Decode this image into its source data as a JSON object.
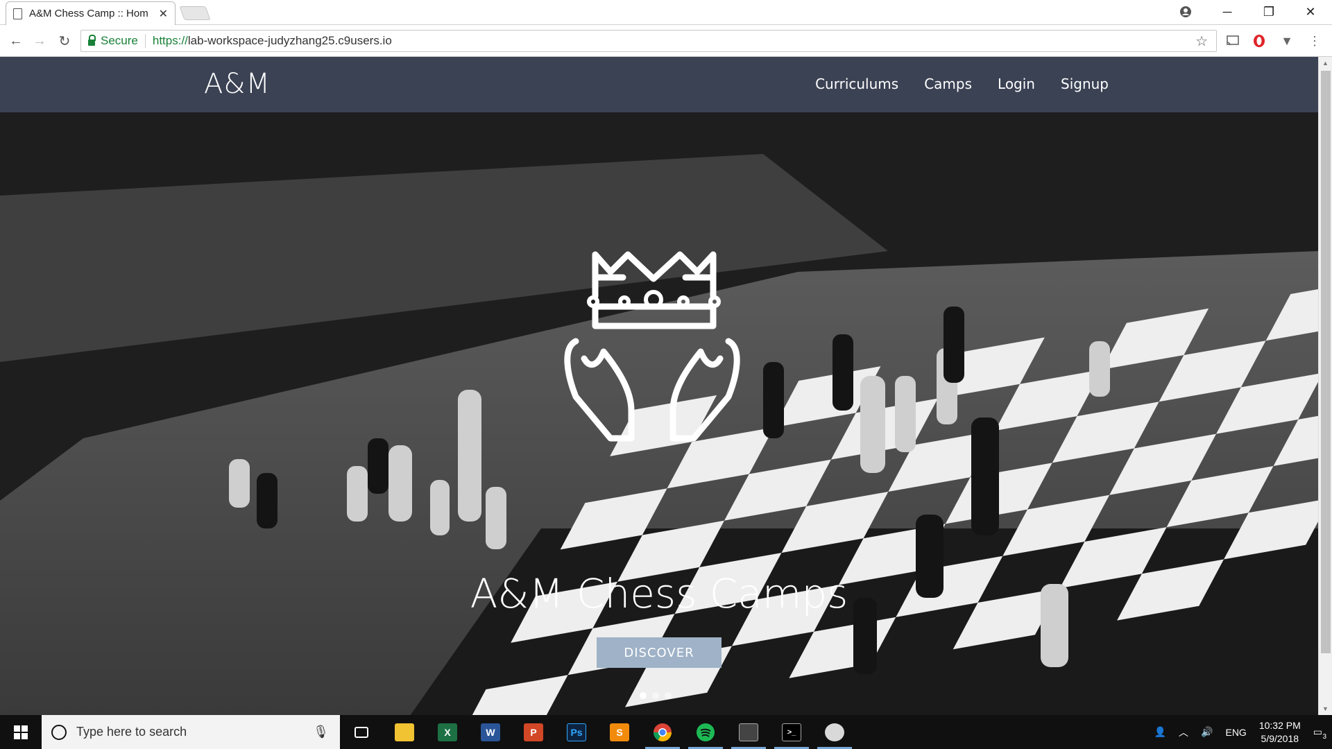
{
  "browser": {
    "tab_title": "A&M Chess Camp :: Hom",
    "secure_label": "Secure",
    "url_scheme": "https://",
    "url_rest": "lab-workspace-judyzhang25.c9users.io"
  },
  "site": {
    "brand": "A&M",
    "nav": [
      "Curriculums",
      "Camps",
      "Login",
      "Signup"
    ]
  },
  "hero": {
    "title": "A&M Chess Camps",
    "button": "DISCOVER",
    "slide_count": 3,
    "active_slide": 0
  },
  "taskbar": {
    "search_placeholder": "Type here to search",
    "language": "ENG",
    "time": "10:32 PM",
    "date": "5/9/2018",
    "notification_count": "3"
  },
  "colors": {
    "navbar": "#3b4254",
    "discover_button": "#9fb2c7",
    "secure_green": "#188038"
  }
}
